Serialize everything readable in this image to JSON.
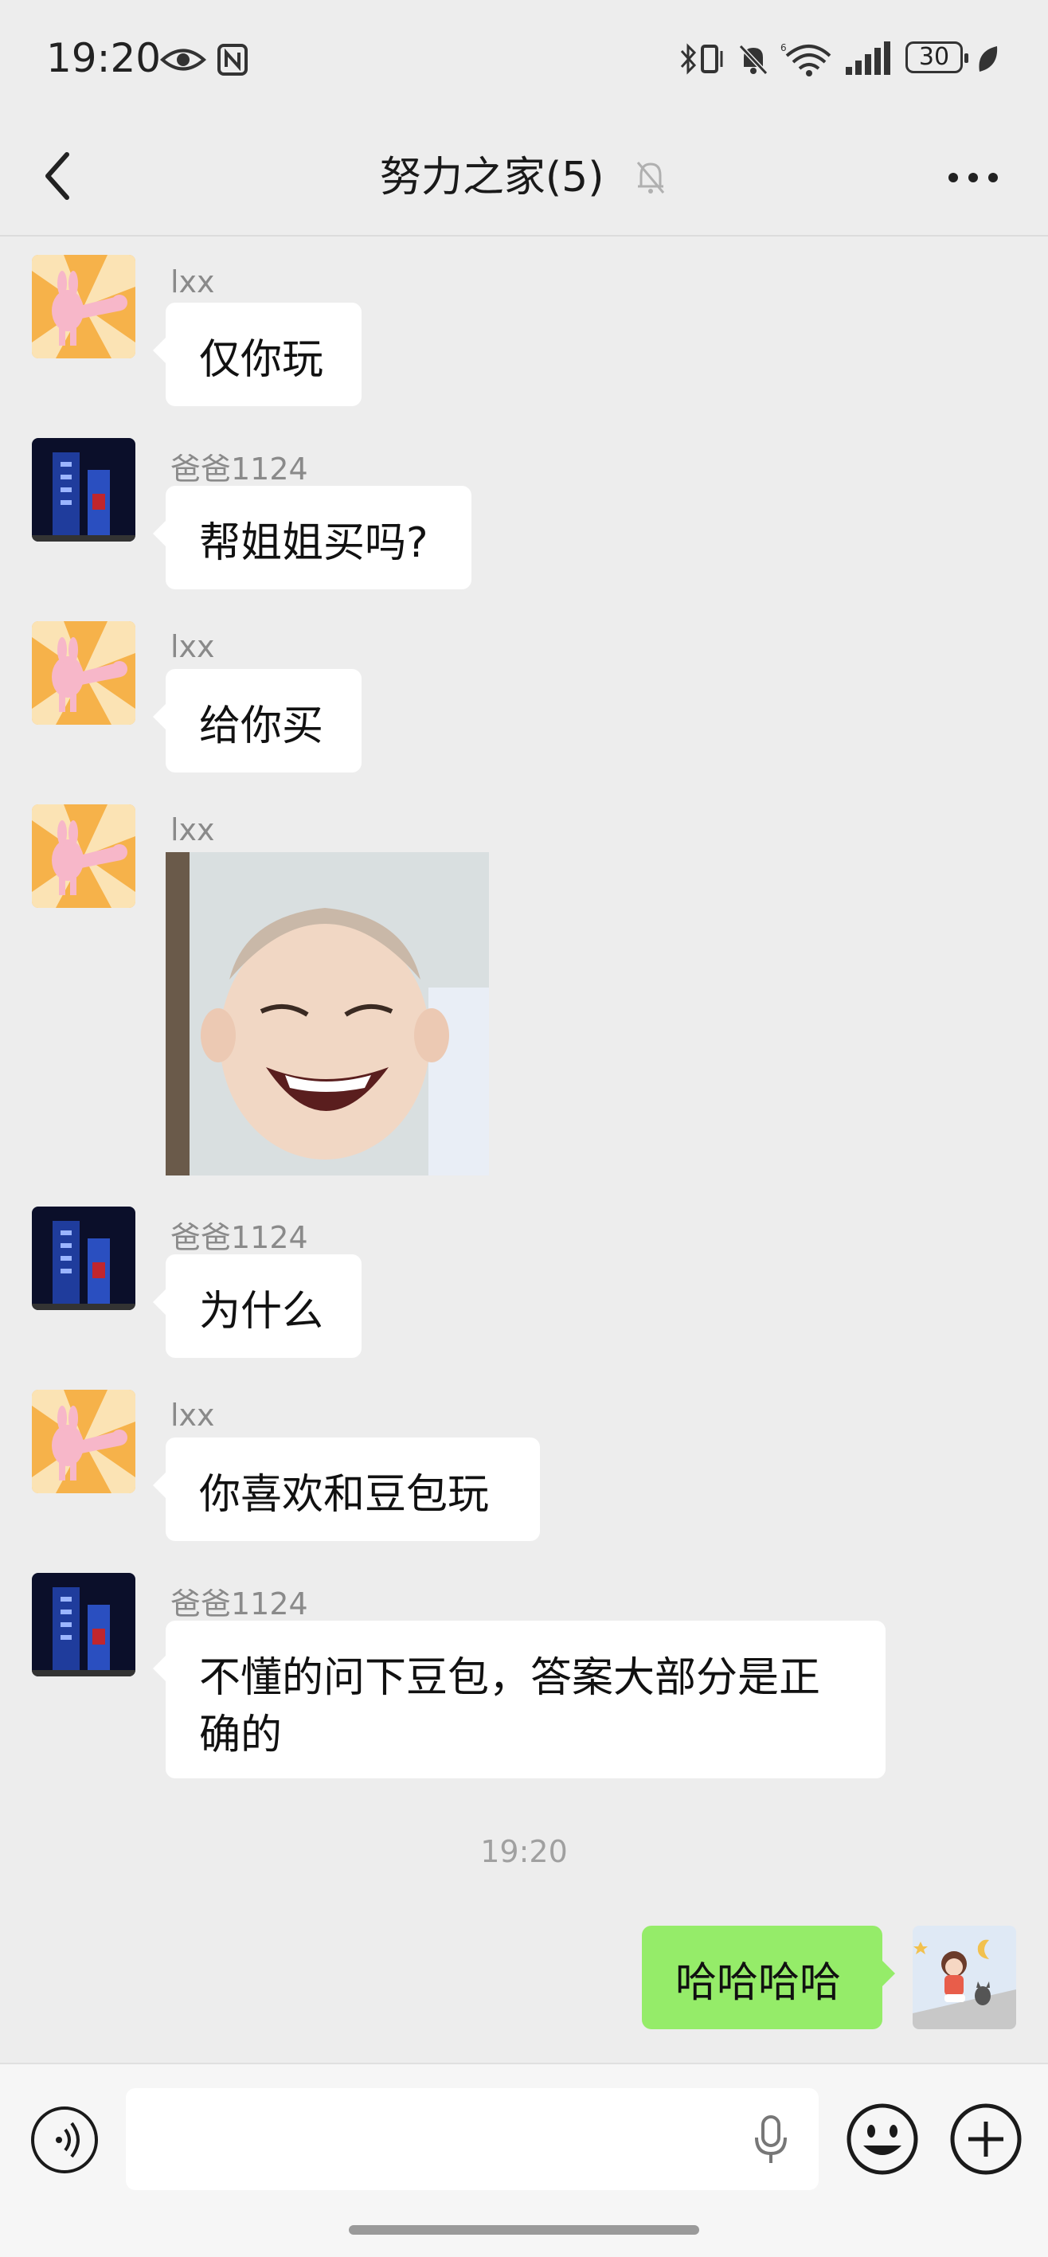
{
  "status_bar": {
    "time": "19:20",
    "battery": "30"
  },
  "header": {
    "title": "努力之家(5)"
  },
  "messages": [
    {
      "sender": "lxx",
      "text": "仅你玩"
    },
    {
      "sender": "爸爸1124",
      "text": "帮姐姐买吗?"
    },
    {
      "sender": "lxx",
      "text": "给你买"
    },
    {
      "sender": "lxx",
      "image": "laughing-baby-sticker"
    },
    {
      "sender": "爸爸1124",
      "text": "为什么"
    },
    {
      "sender": "lxx",
      "text": "你喜欢和豆包玩"
    },
    {
      "sender": "爸爸1124",
      "text": "不懂的问下豆包，答案大部分是正确的"
    }
  ],
  "timestamp": "19:20",
  "self_message": {
    "text": "哈哈哈哈"
  },
  "input_bar": {
    "draft": ""
  },
  "colors": {
    "background": "#ededed",
    "self_bubble": "#95ec69",
    "other_bubble": "#ffffff"
  },
  "icons": [
    "back-icon",
    "mute-bell-icon",
    "more-icon",
    "voice-icon",
    "microphone-icon",
    "emoji-icon",
    "plus-icon"
  ]
}
